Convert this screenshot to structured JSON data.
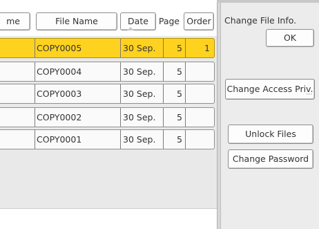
{
  "header": {
    "col_name_partial": "me",
    "col_file_name": "File Name",
    "col_date": "Date",
    "col_page": "Page",
    "col_order": "Order"
  },
  "rows": [
    {
      "name": "COPY0005",
      "date": "30 Sep.",
      "page": "5",
      "order": "1",
      "selected": true
    },
    {
      "name": "COPY0004",
      "date": "30 Sep.",
      "page": "5",
      "order": "",
      "selected": false
    },
    {
      "name": "COPY0003",
      "date": "30 Sep.",
      "page": "5",
      "order": "",
      "selected": false
    },
    {
      "name": "COPY0002",
      "date": "30 Sep.",
      "page": "5",
      "order": "",
      "selected": false
    },
    {
      "name": "COPY0001",
      "date": "30 Sep.",
      "page": "5",
      "order": "",
      "selected": false
    }
  ],
  "right_panel": {
    "title": "Change File Info.",
    "ok_label": "OK",
    "change_access_label": "Change Access Priv.",
    "unlock_label": "Unlock Files",
    "change_password_label": "Change Password"
  },
  "colors": {
    "selected_row": "#ffd21f",
    "panel_bg": "#ececec",
    "list_bg": "#e9e9e9"
  }
}
